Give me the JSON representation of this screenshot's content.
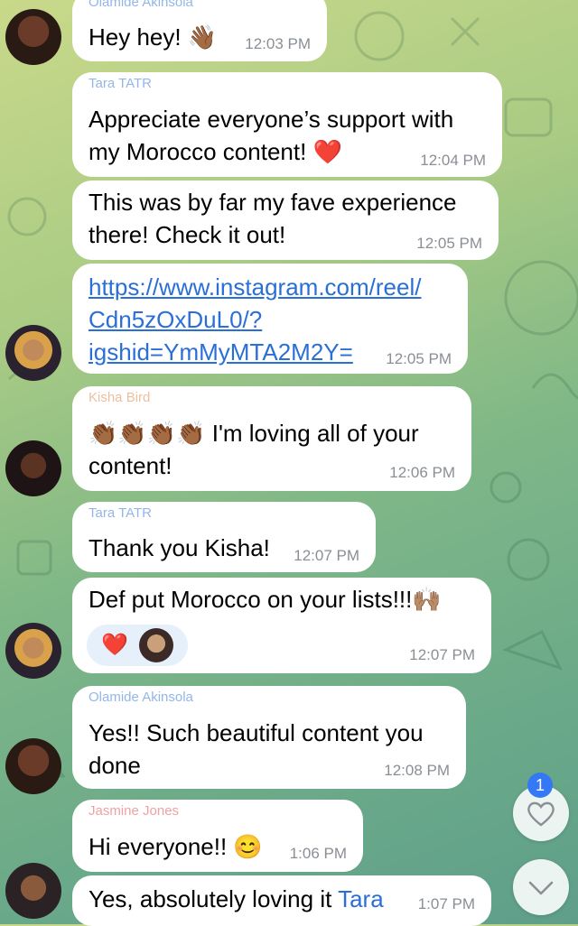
{
  "messages": [
    {
      "sender": "Olamide Akinsola",
      "lines": [
        "Hey hey! 👋🏾"
      ],
      "time": "12:03 PM"
    },
    {
      "sender": "Tara TATR",
      "lines": [
        "Appreciate everyone’s support with",
        "my Morocco content! ❤️"
      ],
      "time": "12:04 PM"
    },
    {
      "lines": [
        "This was by far my fave experience",
        "there! Check it out!"
      ],
      "time": "12:05 PM"
    },
    {
      "link_lines": [
        "https://www.instagram.com/reel/",
        "Cdn5zOxDuL0/?",
        "igshid=YmMyMTA2M2Y="
      ],
      "time": "12:05 PM"
    },
    {
      "sender": "Kisha Bird",
      "lines": [
        "👏🏾👏🏾👏🏾👏🏾 I'm loving all of your",
        "content!"
      ],
      "time": "12:06 PM"
    },
    {
      "sender": "Tara TATR",
      "lines": [
        "Thank you Kisha!"
      ],
      "time": "12:07 PM"
    },
    {
      "lines": [
        "Def put Morocco on your lists!!!🙌🏽"
      ],
      "reaction": "❤️",
      "time": "12:07 PM"
    },
    {
      "sender": "Olamide Akinsola",
      "lines": [
        "Yes!! Such beautiful content you",
        "done"
      ],
      "time": "12:08 PM"
    },
    {
      "sender": "Jasmine Jones",
      "lines": [
        "Hi everyone!! 😊"
      ],
      "time": "1:06 PM"
    },
    {
      "lines_prefix": "Yes, absolutely loving it ",
      "mention": "Tara",
      "time": "1:07 PM"
    }
  ],
  "reactions_badge": "1",
  "icons": {
    "reactions_button": "heart-icon",
    "scroll_down_button": "chevron-down-icon"
  }
}
